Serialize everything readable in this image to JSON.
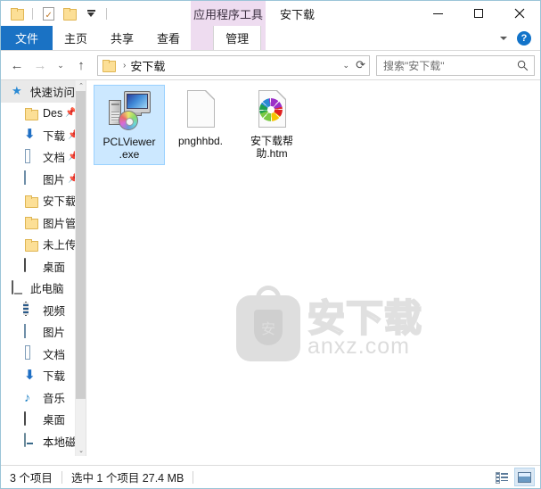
{
  "window": {
    "title": "安下载",
    "contextual_tab_header": "应用程序工具",
    "controls": {
      "minimize": "minimize-icon",
      "maximize": "maximize-icon",
      "close": "close-icon"
    }
  },
  "quick_access_toolbar": {
    "items": [
      {
        "name": "folder-icon",
        "label": ""
      },
      {
        "name": "properties-icon",
        "label": ""
      },
      {
        "name": "new-folder-icon",
        "label": ""
      },
      {
        "name": "customize-dropdown-icon",
        "label": ""
      }
    ]
  },
  "ribbon": {
    "tabs": [
      {
        "label": "文件",
        "state": "file"
      },
      {
        "label": "主页",
        "state": "normal"
      },
      {
        "label": "共享",
        "state": "normal"
      },
      {
        "label": "查看",
        "state": "normal"
      },
      {
        "label": "管理",
        "state": "selected"
      }
    ],
    "collapse_icon": "chevron-down-icon",
    "help_label": "?"
  },
  "address_bar": {
    "back_icon": "←",
    "forward_icon": "→",
    "history_icon": "⌄",
    "up_icon": "↑",
    "breadcrumb": {
      "folder_icon": "folder-icon",
      "separator": "›",
      "path": "安下载"
    },
    "path_dropdown_icon": "⌄",
    "refresh_icon": "⟳"
  },
  "search": {
    "placeholder": "搜索\"安下载\"",
    "icon": "search-icon"
  },
  "sidebar": {
    "items": [
      {
        "label": "快速访问",
        "icon": "star-pin-icon",
        "level": "root",
        "selected": true,
        "pinned": false
      },
      {
        "label": "Des",
        "icon": "folder-icon",
        "level": "child",
        "pinned": true
      },
      {
        "label": "下载",
        "icon": "download-icon",
        "level": "child",
        "pinned": true
      },
      {
        "label": "文档",
        "icon": "documents-icon",
        "level": "child",
        "pinned": true
      },
      {
        "label": "图片",
        "icon": "pictures-icon",
        "level": "child",
        "pinned": true
      },
      {
        "label": "安下载",
        "icon": "folder-icon",
        "level": "child",
        "pinned": false
      },
      {
        "label": "图片管",
        "icon": "folder-icon",
        "level": "child",
        "pinned": false
      },
      {
        "label": "未上传",
        "icon": "folder-icon",
        "level": "child",
        "pinned": false
      },
      {
        "label": "桌面",
        "icon": "desktop-icon",
        "level": "child",
        "pinned": false
      },
      {
        "label": "此电脑",
        "icon": "this-pc-icon",
        "level": "root",
        "pinned": false
      },
      {
        "label": "视频",
        "icon": "videos-icon",
        "level": "child",
        "pinned": false
      },
      {
        "label": "图片",
        "icon": "pictures-icon",
        "level": "child",
        "pinned": false
      },
      {
        "label": "文档",
        "icon": "documents-icon",
        "level": "child",
        "pinned": false
      },
      {
        "label": "下载",
        "icon": "download-icon",
        "level": "child",
        "pinned": false
      },
      {
        "label": "音乐",
        "icon": "music-icon",
        "level": "child",
        "pinned": false
      },
      {
        "label": "桌面",
        "icon": "desktop-icon",
        "level": "child",
        "pinned": false
      },
      {
        "label": "本地磁",
        "icon": "local-disk-icon",
        "level": "child",
        "pinned": false
      }
    ],
    "scroll_up_icon": "⌃",
    "scroll_down_icon": "⌄"
  },
  "files": [
    {
      "name": "PCLViewer\n.exe",
      "name_line1": "PCLViewer",
      "name_line2": ".exe",
      "icon": "exe-application-icon",
      "selected": true
    },
    {
      "name": "pnghhbd.",
      "name_line1": "pnghhbd.",
      "name_line2": "",
      "icon": "blank-file-icon",
      "selected": false
    },
    {
      "name": "安下载帮助.htm",
      "name_line1": "安下载帮",
      "name_line2": "助.htm",
      "icon": "html-document-icon",
      "selected": false
    }
  ],
  "watermark": {
    "badge_char": "安",
    "text_cn": "安下载",
    "text_en": "anxz.com"
  },
  "status_bar": {
    "item_count": "3 个项目",
    "selection": "选中 1 个项目  27.4 MB",
    "view_details_icon": "details-view-icon",
    "view_large_icons_icon": "large-icons-view-icon"
  }
}
